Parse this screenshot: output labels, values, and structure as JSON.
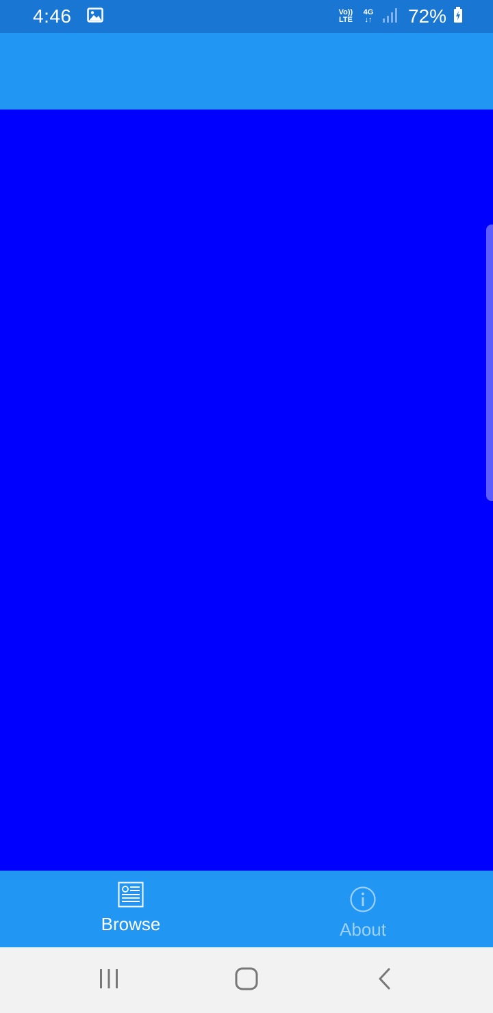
{
  "status_bar": {
    "time": "4:46",
    "volte_top": "Vo))",
    "volte_bottom": "LTE",
    "network": "4G",
    "battery_percent": "72%",
    "icons": [
      "gallery-icon",
      "volte-icon",
      "network-4g-icon",
      "signal-icon",
      "battery-charging-icon"
    ]
  },
  "colors": {
    "status_bar": "#1976d2",
    "app_bar": "#2196f3",
    "content": "#0000ff",
    "bottom_nav": "#2196f3",
    "system_nav": "#f2f2f2"
  },
  "bottom_nav": {
    "items": [
      {
        "label": "Browse",
        "icon": "browse-icon",
        "active": true
      },
      {
        "label": "About",
        "icon": "info-icon",
        "active": false
      }
    ]
  },
  "system_nav": {
    "buttons": [
      "recent-apps-icon",
      "home-icon",
      "back-icon"
    ]
  }
}
